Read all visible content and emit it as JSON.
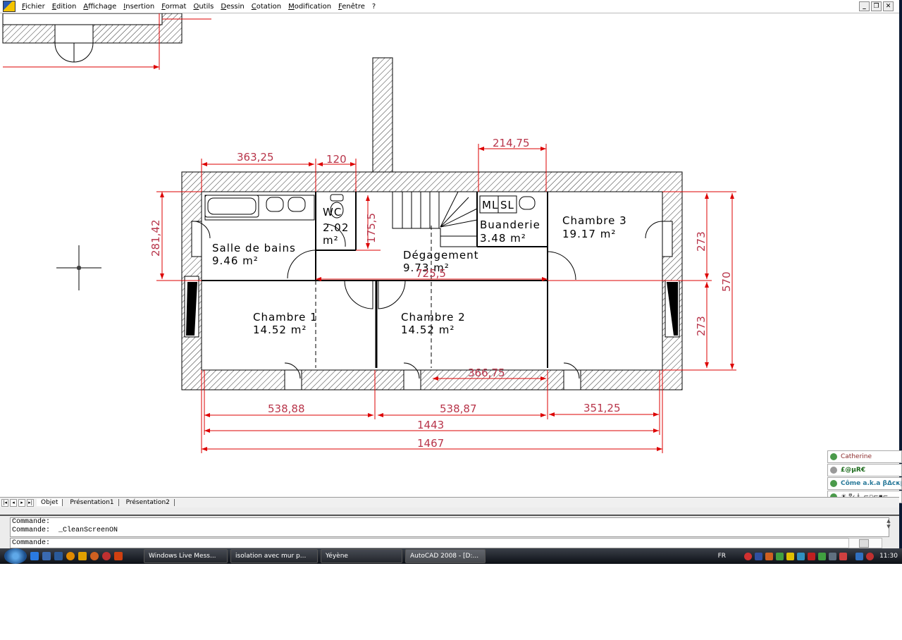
{
  "menu": {
    "items": [
      "Fichier",
      "Edition",
      "Affichage",
      "Insertion",
      "Format",
      "Outils",
      "Dessin",
      "Cotation",
      "Modification",
      "Fenêtre",
      "?"
    ]
  },
  "window_controls": {
    "minimize": "_",
    "restore": "❐",
    "close": "✕"
  },
  "drawing": {
    "rooms": [
      {
        "name": "Salle de bains",
        "area": "9.46 m²"
      },
      {
        "name": "WC",
        "area": "2.02",
        "unit": "m²"
      },
      {
        "name": "Dégagement",
        "area": "9.73 m²"
      },
      {
        "name": "Buanderie",
        "area": "3.48 m²"
      },
      {
        "name": "Chambre 3",
        "area": "19.17 m²"
      },
      {
        "name": "Chambre 1",
        "area": "14.52 m²"
      },
      {
        "name": "Chambre 2",
        "area": "14.52 m²"
      }
    ],
    "fixtures": {
      "ml": "ML",
      "sl": "SL"
    },
    "dimensions": {
      "d1": "363,25",
      "d2": "120",
      "d3": "214,75",
      "d4": "281,42",
      "d5": "175,5",
      "d6": "725,5",
      "d7": "273",
      "d8": "273",
      "d9": "570",
      "d10": "366,75",
      "d11": "538,88",
      "d12": "538,87",
      "d13": "351,25",
      "d14": "1443",
      "d15": "1467"
    },
    "colors": {
      "dimension": "#c00000",
      "wall": "#000000",
      "hatch": "#333333"
    }
  },
  "layout_tabs": {
    "items": [
      "Objet",
      "Présentation1",
      "Présentation2"
    ],
    "active": "Objet"
  },
  "command": {
    "history": [
      "Commande:",
      "Commande:  _CleanScreenON"
    ],
    "prompt": "Commande:"
  },
  "taskbar": {
    "tasks": [
      "Windows Live Mess...",
      "isolation avec mur p...",
      "Yéyène",
      "AutoCAD 2008 - [D:..."
    ],
    "active": "AutoCAD 2008 - [D:...",
    "language": "FR",
    "clock": "11:30"
  },
  "contacts": [
    {
      "name": "Catherine",
      "color": "#8b2a2a"
    },
    {
      "name": "£@µR€",
      "color": "#1a6a1a"
    },
    {
      "name": "Côme a.k.a βΔcκβι...",
      "color": "#2a7a9a"
    },
    {
      "name": "☀ ͳ‹.ɫ.,⌐▫⌐▪⌐.",
      "color": "#333333"
    }
  ]
}
